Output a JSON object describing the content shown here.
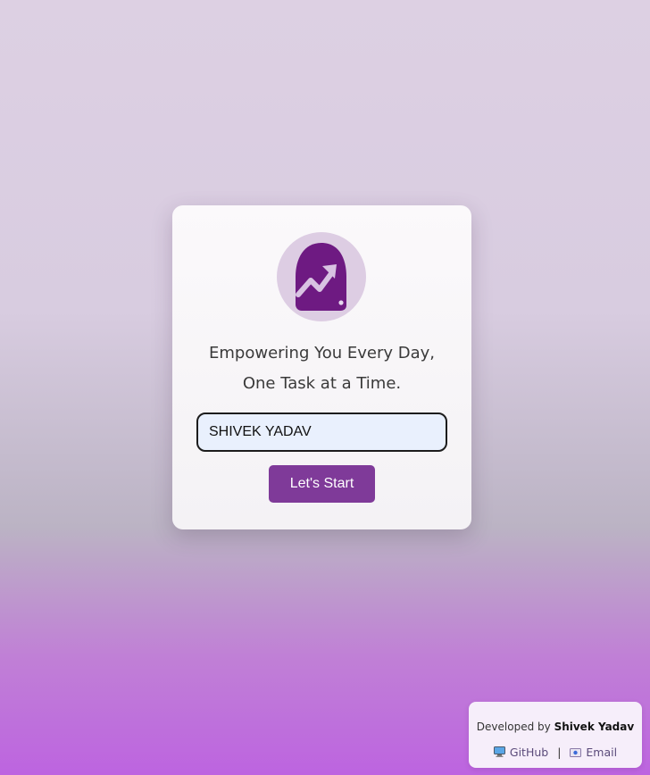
{
  "card": {
    "tagline_line1": "Empowering You Every Day,",
    "tagline_line2": "One Task at a Time.",
    "name_input_value": "SHIVEK YADAV",
    "start_button_label": "Let's Start",
    "logo_icon": "growth-chart-icon"
  },
  "footer": {
    "developed_by_prefix": "Developed by",
    "developer_name": "Shivek Yadav",
    "github_label": "GitHub",
    "github_icon": "computer-icon",
    "separator": "|",
    "email_label": "Email",
    "email_icon": "email-icon"
  },
  "colors": {
    "accent": "#7f3a99",
    "logo_fill": "#6e1a82",
    "logo_circle": "#ddcde3",
    "input_bg": "#e9f0fd"
  }
}
